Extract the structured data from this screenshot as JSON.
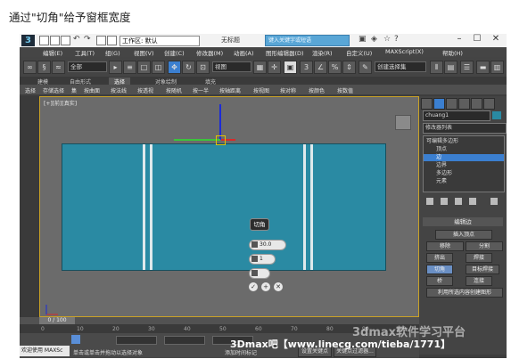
{
  "caption": "通过\"切角\"给予窗框宽度",
  "titlebar": {
    "workspace": "工作区: 默认",
    "doc_title": "无标题",
    "search_placeholder": "键入关键字或短语",
    "logo": "3"
  },
  "menu": [
    "编辑(E)",
    "工具(T)",
    "组(G)",
    "视图(V)",
    "创建(C)",
    "修改器(M)",
    "动画(A)",
    "图形编辑器(D)",
    "渲染(R)",
    "自定义(U)",
    "MAXScript(X)",
    "帮助(H)"
  ],
  "toolbar": {
    "select_filter": "全部",
    "ref_coord": "视图",
    "named_set": "创建选择集"
  },
  "ribbon_tabs": [
    "建模",
    "自由形式",
    "选择",
    "对象绘制",
    "填充"
  ],
  "ribbon_active": "选择",
  "ribbon_items": [
    "选择",
    "存储选择",
    "集",
    "按曲面",
    "按法线",
    "按透视",
    "按随机",
    "按一半",
    "按轴距离",
    "按视图",
    "按对称",
    "按颜色",
    "按数值"
  ],
  "viewport": {
    "label": "[+][前][真实]"
  },
  "caddy": {
    "title": "切角",
    "amount": "30.0",
    "segments": "1"
  },
  "command_panel": {
    "object_name": "chuang1",
    "modifier_list": "修改器列表",
    "stack": [
      "可编辑多边形",
      "顶点",
      "边",
      "边界",
      "多边形",
      "元素"
    ],
    "stack_selected": 2,
    "rollout": "编辑边",
    "buttons": {
      "insert_vertex": "插入顶点",
      "remove": "移除",
      "split": "分割",
      "extrude": "挤出",
      "weld": "焊接",
      "chamfer": "切角",
      "target_weld": "目标焊接",
      "bridge": "桥",
      "connect": "连接",
      "create_shape": "利用所选内容创建图形"
    }
  },
  "timeline": {
    "slider": "0 / 100",
    "ticks": [
      "0",
      "10",
      "20",
      "30",
      "40",
      "50",
      "60",
      "70",
      "80",
      "90",
      "100"
    ]
  },
  "statusbar": {
    "welcome": "欢迎使用 MAXSc",
    "hint": "单击或单击并拖动以选择对象",
    "add_marker": "添加时间标记",
    "set_key": "设置关键点",
    "key_filter": "关键点过滤器..."
  },
  "watermark": {
    "text1": "3Dmax吧【www.linecg.com/tieba/1771】",
    "text2": "3dmax软件学习平台"
  },
  "colors": {
    "object": "#2a8aa3",
    "viewport_border": "#c9a227",
    "selection": "#3b7fd0",
    "search": "#59a6d6"
  }
}
